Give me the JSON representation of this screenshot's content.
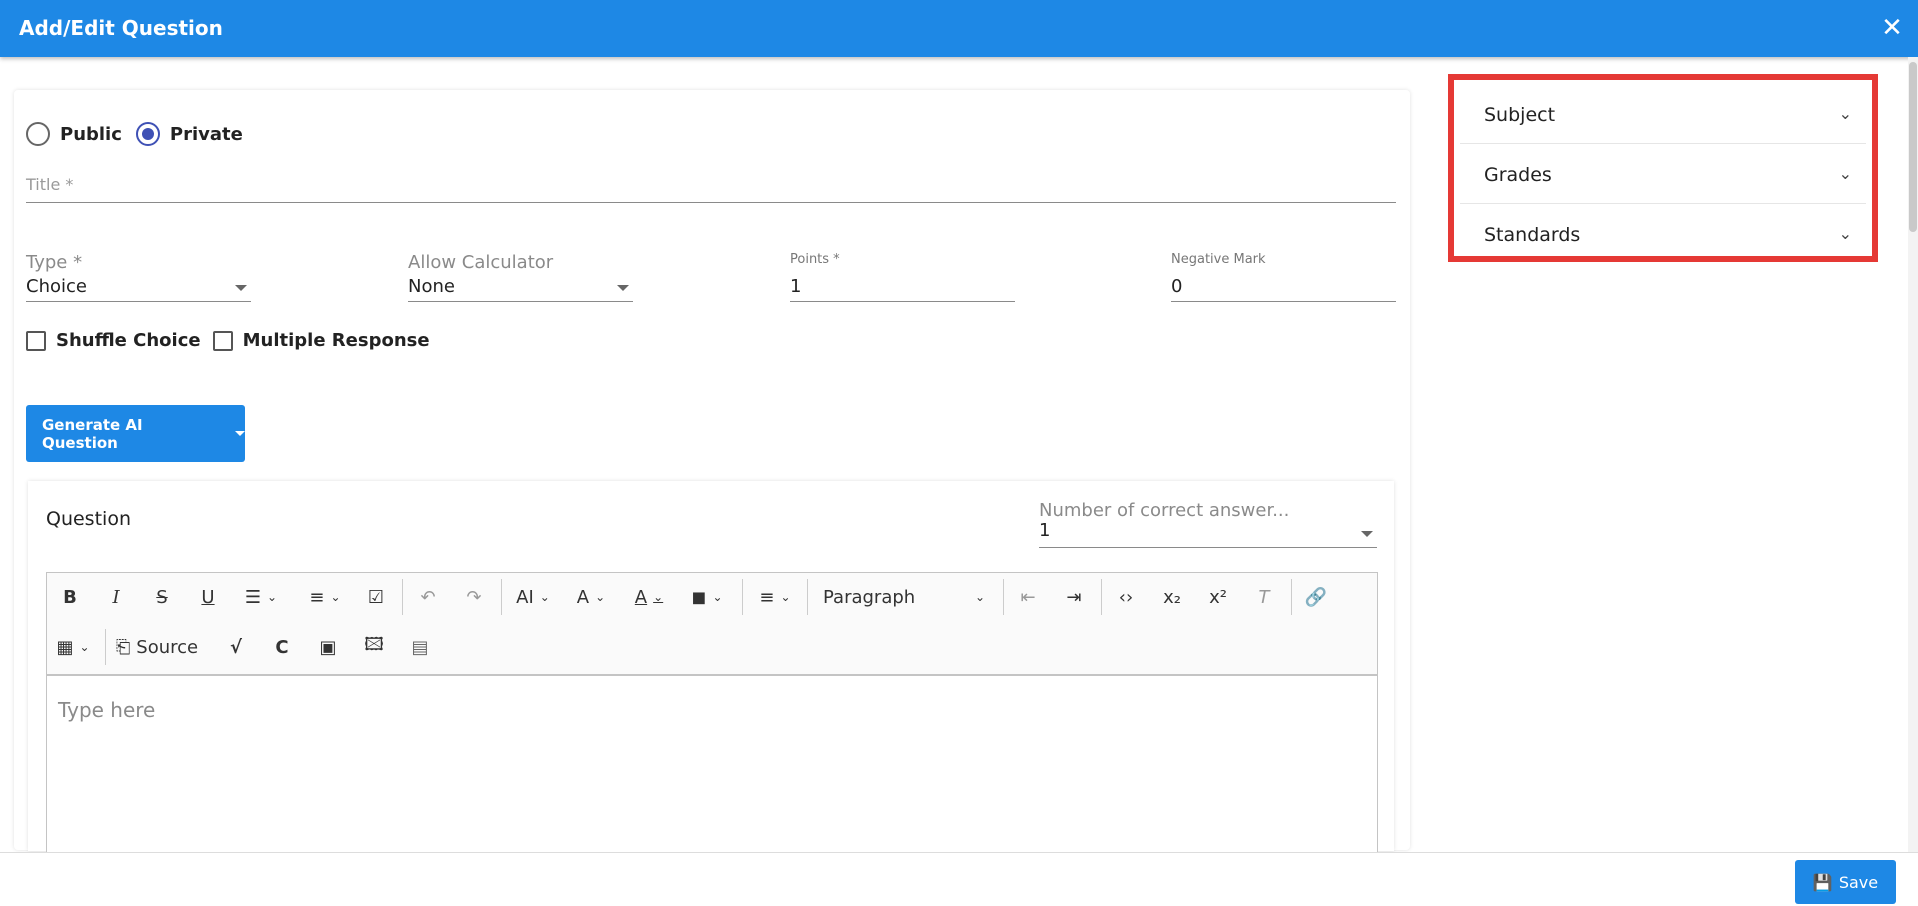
{
  "header": {
    "title": "Add/Edit Question",
    "close_icon": "close-icon"
  },
  "visibility": {
    "options": [
      {
        "label": "Public",
        "selected": false
      },
      {
        "label": "Private",
        "selected": true
      }
    ]
  },
  "title_field": {
    "label": "Title *",
    "value": ""
  },
  "fields": {
    "type": {
      "label": "Type *",
      "value": "Choice"
    },
    "calculator": {
      "label": "Allow Calculator",
      "value": "None"
    },
    "points": {
      "label": "Points *",
      "value": "1"
    },
    "negative": {
      "label": "Negative Mark",
      "value": "0"
    }
  },
  "checkboxes": [
    {
      "label": "Shuffle Choice",
      "checked": false
    },
    {
      "label": "Multiple Response",
      "checked": false
    }
  ],
  "generate_button": {
    "label": "Generate AI Question"
  },
  "question": {
    "title": "Question",
    "correct_answers": {
      "label": "Number of correct answer...",
      "value": "1"
    },
    "toolbar": {
      "paragraph": "Paragraph",
      "source": "Source"
    },
    "editor_placeholder": "Type here"
  },
  "right_panel": {
    "items": [
      {
        "label": "Subject"
      },
      {
        "label": "Grades"
      },
      {
        "label": "Standards"
      }
    ]
  },
  "footer": {
    "save_label": "Save"
  },
  "colors": {
    "primary": "#1e88e5",
    "highlight_border": "#e53935",
    "radio_selected": "#3f51b5"
  }
}
